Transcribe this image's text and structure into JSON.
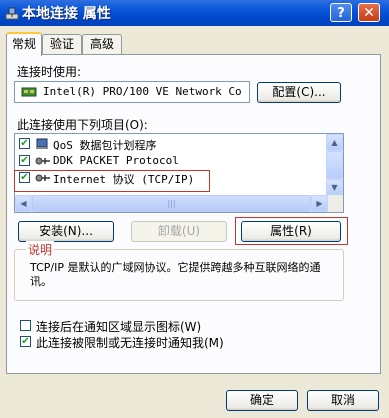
{
  "window": {
    "title": "本地连接 属性",
    "help_glyph": "?",
    "close_glyph": "✕"
  },
  "tabs": [
    {
      "label": "常规",
      "active": true
    },
    {
      "label": "验证",
      "active": false
    },
    {
      "label": "高级",
      "active": false
    }
  ],
  "connection": {
    "label": "连接时使用:",
    "adapter": "Intel(R) PRO/100 VE Network Co",
    "configure_button": "配置(C)..."
  },
  "components": {
    "label": "此连接使用下列项目(O):",
    "items": [
      {
        "checked": true,
        "icon": "qos-icon",
        "label": "QoS 数据包计划程序"
      },
      {
        "checked": true,
        "icon": "protocol-icon",
        "label": "DDK PACKET Protocol"
      },
      {
        "checked": true,
        "icon": "protocol-icon",
        "label": "Internet 协议 (TCP/IP)"
      }
    ],
    "scroll_up_glyph": "▲",
    "scroll_down_glyph": "▼",
    "scroll_left_glyph": "◀",
    "scroll_right_glyph": "▶",
    "thumb_grip": "|||"
  },
  "actions": {
    "install": "安装(N)...",
    "uninstall": "卸载(U)",
    "properties": "属性(R)"
  },
  "description": {
    "title": "说明",
    "text": "TCP/IP 是默认的广域网协议。它提供跨越多种互联网络的通讯。"
  },
  "options": [
    {
      "checked": false,
      "label": "连接后在通知区域显示图标(W)"
    },
    {
      "checked": true,
      "label": "此连接被限制或无连接时通知我(M)"
    }
  ],
  "footer": {
    "ok": "确定",
    "cancel": "取消"
  },
  "colors": {
    "highlight": "#c2362e",
    "titlebar": "#0047c9"
  }
}
